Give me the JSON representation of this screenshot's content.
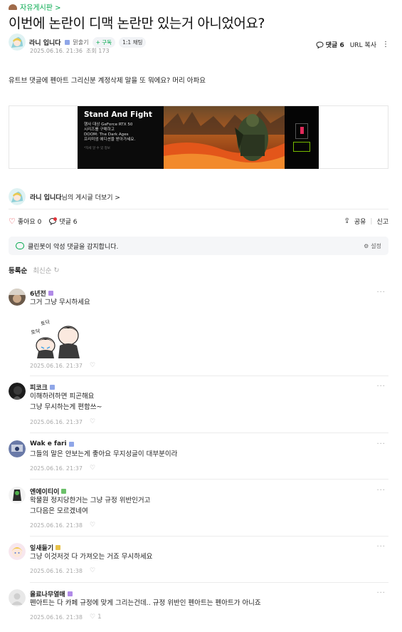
{
  "breadcrumb": {
    "label": "자유게시판 >"
  },
  "post": {
    "title": "이번에 논란이 디맥 논란만 있는거 아니었어요?",
    "author": "라니 입니다",
    "grade": "맑출기",
    "subscribe": "+ 구독",
    "chat": "1:1 채팅",
    "date": "2025.06.16. 21:36",
    "views": "조회 173",
    "comment_count_label": "댓글 6",
    "copy_url": "URL 복사",
    "body": "유트브 댓글에 펜아트 그리신분 계정삭제 말을 또 뭐에요? 머리 아파요"
  },
  "ad": {
    "title": "Stand And Fight",
    "lines": [
      "행사 대상 GeForce RTX 50",
      "시리즈를 구매하고",
      "DOOM: The Dark Ages",
      "프리미엄 에디션을 받아가세요."
    ],
    "fine": "*자세 알 수 있 정보"
  },
  "profile_link": {
    "name": "라니 입니다",
    "suffix": "님의 게시글 더보기 >"
  },
  "actions": {
    "like": "좋아요 0",
    "comments": "댓글 6",
    "share": "공유",
    "report": "신고"
  },
  "cleanbot": {
    "text": "클린봇이 악성 댓글을 감지합니다.",
    "settings": "설정"
  },
  "sort": {
    "active": "등록순",
    "inactive": "최신순"
  },
  "comments": [
    {
      "name": "6년전",
      "lines": [
        "그거 그냥 무시하세요"
      ],
      "date": "2025.06.16. 21:37",
      "likes": "",
      "sticker_text": "토닥",
      "badge_color": "#b18be8"
    },
    {
      "name": "피코크",
      "lines": [
        "이해하려하면 피곤해요",
        "그냥 무시하는게 편함쓰~"
      ],
      "date": "2025.06.16. 21:37",
      "likes": "",
      "badge_color": "#8fa6e8"
    },
    {
      "name": "Wak e fari",
      "lines": [
        "그들의 말은 안보는게 좋아요 무지성글이 대부분이라"
      ],
      "date": "2025.06.16. 21:37",
      "likes": "",
      "badge_color": "#8fa6e8"
    },
    {
      "name": "엔에이티이",
      "lines": [
        "왁물원 정지당한거는 그냥 규정 위반인거고",
        "그다음은 모르겠네여"
      ],
      "date": "2025.06.16. 21:38",
      "likes": "",
      "badge_color": "#6cc06a"
    },
    {
      "name": "잎새들기",
      "lines": [
        "그냥 이것저것 다 가져오는 거죠 무시하세요"
      ],
      "date": "2025.06.16. 21:38",
      "likes": "",
      "badge_color": "#e8c24a"
    },
    {
      "name": "올료나무열매",
      "lines": [
        "펜아트는 다 카페 규정에 맞게 그리는건데.. 규정 위반인 펜아트는 펜아트가 아니죠"
      ],
      "date": "2025.06.16. 21:38",
      "likes": "1",
      "badge_color": "#b18be8"
    }
  ]
}
